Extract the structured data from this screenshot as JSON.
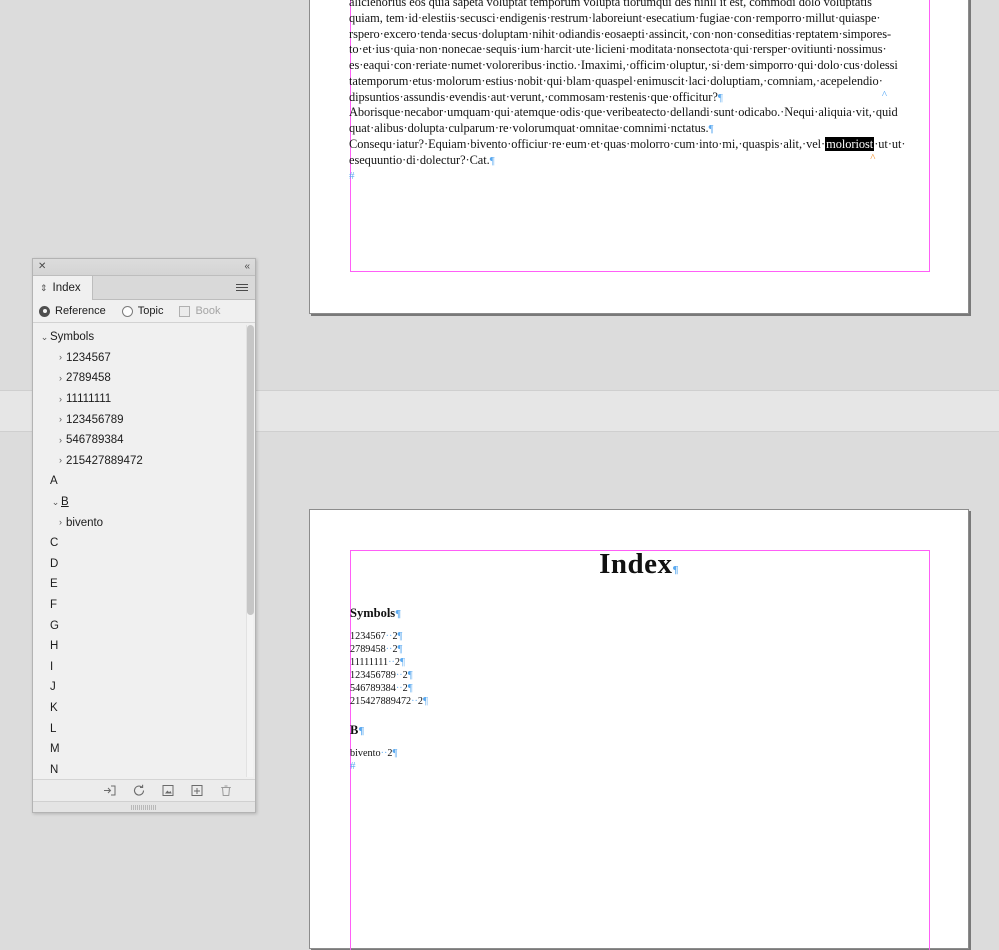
{
  "app": {
    "panel_title": "Index"
  },
  "panel": {
    "titlebar": {
      "close_icon": "✕",
      "collapse_icon": "«"
    },
    "tab": {
      "grip_icon": "⇕",
      "label": "Index",
      "menu_icon": "panel-menu-icon"
    },
    "modes": {
      "reference_label": "Reference",
      "topic_label": "Topic",
      "book_label": "Book",
      "selected": "Reference",
      "book_checked": false,
      "book_enabled": false
    },
    "tree": [
      {
        "label": "Symbols",
        "level": 0,
        "twisty": "open",
        "type": "group"
      },
      {
        "label": "1234567",
        "level": 1,
        "twisty": "closed",
        "type": "entry"
      },
      {
        "label": "2789458",
        "level": 1,
        "twisty": "closed",
        "type": "entry"
      },
      {
        "label": "11111111",
        "level": 1,
        "twisty": "closed",
        "type": "entry"
      },
      {
        "label": "123456789",
        "level": 1,
        "twisty": "closed",
        "type": "entry"
      },
      {
        "label": "546789384",
        "level": 1,
        "twisty": "closed",
        "type": "entry"
      },
      {
        "label": "215427889472",
        "level": 1,
        "twisty": "closed",
        "type": "entry"
      },
      {
        "label": "A",
        "level": 0,
        "twisty": "none",
        "type": "letter"
      },
      {
        "label": "B",
        "level": 0,
        "twisty": "open",
        "type": "letter"
      },
      {
        "label": "bivento",
        "level": 1,
        "twisty": "closed",
        "type": "entry"
      },
      {
        "label": "C",
        "level": 0,
        "twisty": "none",
        "type": "letter"
      },
      {
        "label": "D",
        "level": 0,
        "twisty": "none",
        "type": "letter"
      },
      {
        "label": "E",
        "level": 0,
        "twisty": "none",
        "type": "letter"
      },
      {
        "label": "F",
        "level": 0,
        "twisty": "none",
        "type": "letter"
      },
      {
        "label": "G",
        "level": 0,
        "twisty": "none",
        "type": "letter"
      },
      {
        "label": "H",
        "level": 0,
        "twisty": "none",
        "type": "letter"
      },
      {
        "label": "I",
        "level": 0,
        "twisty": "none",
        "type": "letter"
      },
      {
        "label": "J",
        "level": 0,
        "twisty": "none",
        "type": "letter"
      },
      {
        "label": "K",
        "level": 0,
        "twisty": "none",
        "type": "letter"
      },
      {
        "label": "L",
        "level": 0,
        "twisty": "none",
        "type": "letter"
      },
      {
        "label": "M",
        "level": 0,
        "twisty": "none",
        "type": "letter"
      },
      {
        "label": "N",
        "level": 0,
        "twisty": "none",
        "type": "letter"
      }
    ],
    "twisty_open": "⌄",
    "twisty_closed": "›",
    "footer_icons": [
      "generate-index-icon",
      "update-preview-icon",
      "page-reference-icon",
      "new-entry-icon",
      "delete-entry-icon"
    ]
  },
  "document": {
    "story_lines": [
      "aliciehorius eos quia sapeta voluptat temporum volupta tiorumqui des nihil it est, commodi dolo voluptatis",
      "quiam, tem·id·elestiis·secusci·endigenis·restrum·laboreiunt·esecatium·fugiae·con·remporro·millut·quiaspe·",
      "rspero·excero·tenda·secus·doluptam·nihit·odiandis·eosaepti·assincit,·con·non·conseditias·reptatem·simpores-",
      "to·et·ius·quia·non·nonecae·sequis·ium·harcit·ute·licieni·moditata·nonsectota·qui·rersper·ovitiunti·nossimus·",
      "es·eaqui·con·reriate·numet·voloreribus·inctio.·Imaximi,·officim·oluptur,·si·dem·simporro·qui·dolo·cus·dolessi",
      "tatemporum·etus·molorum·estius·nobit·qui·blam·quaspel·enimuscit·laci·doluptiam,·comniam,·acepelendio·",
      "dipsuntios·assundis·evendis·aut·verunt,·commosam·restenis·que·officitur?",
      "Aborisque·necabor·umquam·qui·atemque·odis·que·veribeatecto·dellandi·sunt·odicabo.·Nequi·aliquia·vit,·quid",
      "quat·alibus·dolupta·culparum·re·volorumquat·omnitae·comnimi·nctatus.",
      "Consequ·iatur?·Equiam·bivento·officiur·re·eum·et·quas·molorro·cum·into·mi,·quaspis·alit,·vel·",
      "esequuntio·di·dolectur?·Cat."
    ],
    "selected_text": "moloriost",
    "selected_trailing": "·ut·ut·",
    "pilcrow": "¶",
    "index_page": {
      "title": "Index",
      "sections": [
        {
          "heading": "Symbols",
          "entries": [
            {
              "term": "1234567",
              "page": "2"
            },
            {
              "term": "2789458",
              "page": "2"
            },
            {
              "term": "11111111",
              "page": "2"
            },
            {
              "term": "123456789",
              "page": "2"
            },
            {
              "term": "546789384",
              "page": "2"
            },
            {
              "term": "215427889472",
              "page": "2"
            }
          ]
        },
        {
          "heading": "B",
          "entries": [
            {
              "term": "bivento",
              "page": "2"
            }
          ]
        }
      ]
    }
  },
  "colors": {
    "panel_bg": "#f0f0f0",
    "workspace_bg": "#dcdcdc",
    "margin_guide": "#ff5ef7",
    "index_marker": "#4da3f5",
    "index_marker_active": "#f08a24",
    "selection": "#000000"
  }
}
